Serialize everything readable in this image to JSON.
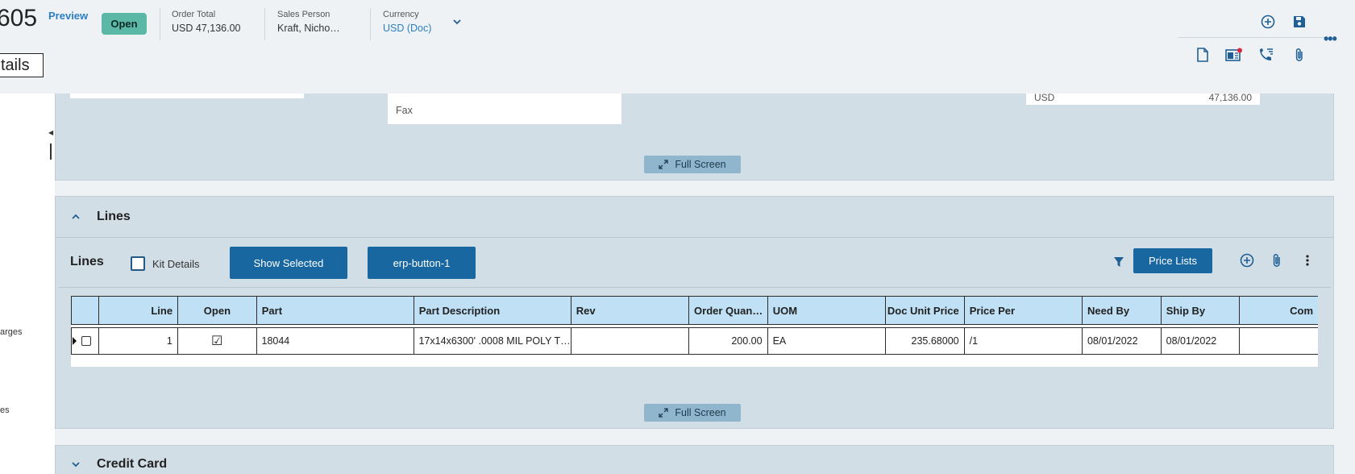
{
  "header": {
    "order_number": "605",
    "preview_label": "Preview",
    "status": "Open",
    "order_total_label": "Order Total",
    "order_total_value": "USD 47,136.00",
    "sales_person_label": "Sales Person",
    "sales_person_value": "Kraft, Nicho…",
    "currency_label": "Currency",
    "currency_value": "USD (Doc)",
    "details_tab": "tails"
  },
  "left_rail": {
    "item_charges": "arges",
    "item_es": "es"
  },
  "top_panel": {
    "fax_label": "Fax",
    "currency": "USD",
    "total": "47,136.00",
    "full_screen_label": "Full Screen"
  },
  "lines_section": {
    "title": "Lines",
    "grid_title": "Lines",
    "kit_details_label": "Kit Details",
    "show_selected_label": "Show Selected",
    "erp_button_label": "erp-button-1",
    "price_lists_label": "Price Lists",
    "full_screen_label": "Full Screen",
    "columns": [
      "Line",
      "Open",
      "Part",
      "Part Description",
      "Rev",
      "Order Quan…",
      "UOM",
      "Doc Unit Price",
      "Price Per",
      "Need By",
      "Ship By",
      "Com"
    ],
    "rows": [
      {
        "line": "1",
        "open": "☑",
        "part": "18044",
        "part_description": "17x14x6300' .0008 MIL POLY T…",
        "rev": "",
        "order_quantity": "200.00",
        "uom": "EA",
        "doc_unit_price": "235.68000",
        "price_per": "/1",
        "need_by": "08/01/2022",
        "ship_by": "08/01/2022",
        "comment": ""
      }
    ]
  },
  "credit_card_section": {
    "title": "Credit Card"
  },
  "colors": {
    "accent_blue": "#1867a0",
    "status_green": "#5bb8a7",
    "panel_bg": "#d2dee5",
    "grid_header": "#bfe0f5"
  }
}
